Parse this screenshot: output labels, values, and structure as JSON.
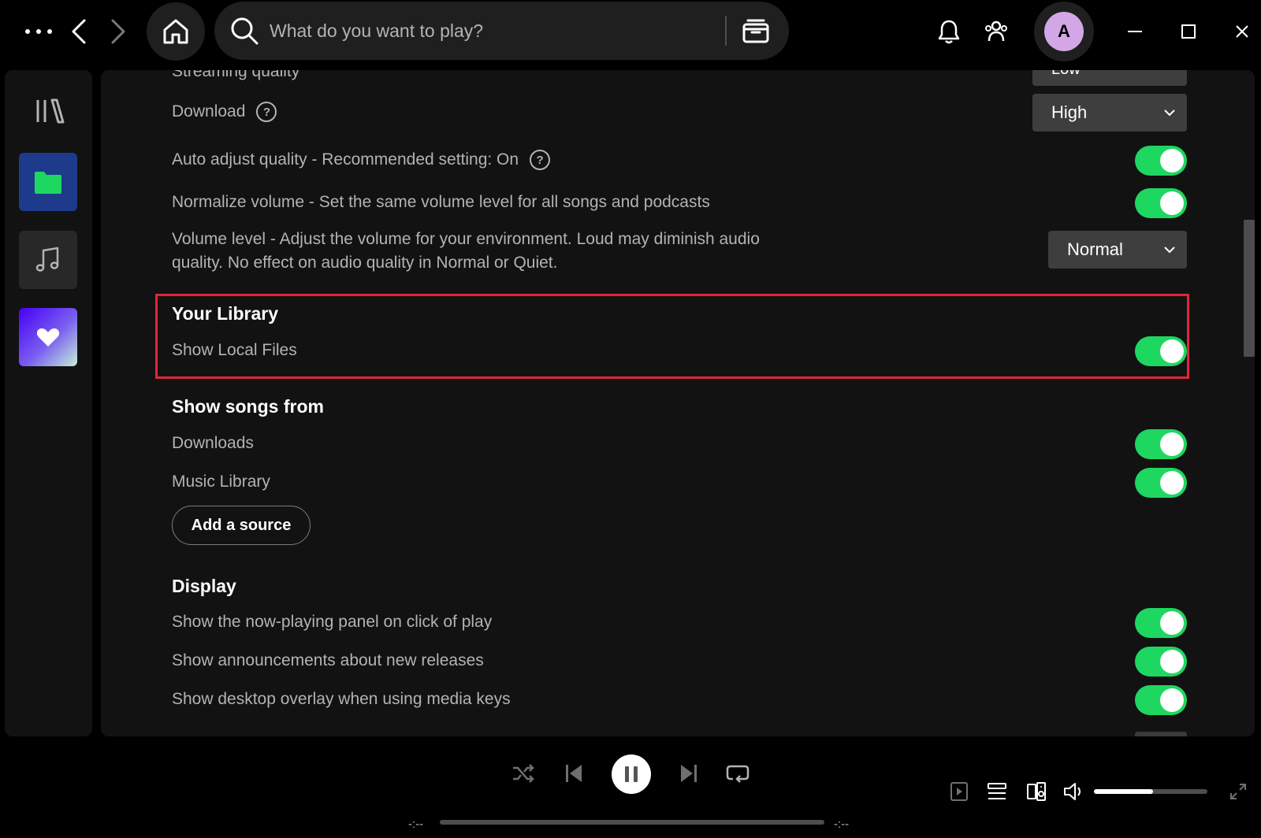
{
  "search": {
    "placeholder": "What do you want to play?"
  },
  "header": {
    "avatar_initial": "A"
  },
  "settings": {
    "partial_row": {
      "label": "Streaming quality",
      "value": "Low"
    },
    "download": {
      "label": "Download",
      "value": "High",
      "help": "?"
    },
    "auto_adjust": {
      "label": "Auto adjust quality - Recommended setting: On",
      "help": "?",
      "on": true
    },
    "normalize": {
      "label": "Normalize volume - Set the same volume level for all songs and podcasts",
      "on": true
    },
    "volume_level": {
      "label_line1": "Volume level - Adjust the volume for your environment. Loud may diminish audio",
      "label_line2": "quality. No effect on audio quality in Normal or Quiet.",
      "value": "Normal"
    },
    "your_library": {
      "title": "Your Library",
      "show_local_files": {
        "label": "Show Local Files",
        "on": true
      }
    },
    "show_songs_from": {
      "title": "Show songs from",
      "items": [
        {
          "label": "Downloads",
          "on": true
        },
        {
          "label": "Music Library",
          "on": true
        }
      ],
      "add_source_label": "Add a source"
    },
    "display": {
      "title": "Display",
      "items": [
        {
          "label": "Show the now-playing panel on click of play",
          "on": true
        },
        {
          "label": "Show announcements about new releases",
          "on": true
        },
        {
          "label": "Show desktop overlay when using media keys",
          "on": true
        }
      ]
    }
  },
  "player": {
    "elapsed": "-:--",
    "remaining": "-:--",
    "progress": 0,
    "volume": 0.52
  },
  "colors": {
    "accent": "#1ed760",
    "highlight": "#e0263a",
    "panel": "#121212"
  }
}
